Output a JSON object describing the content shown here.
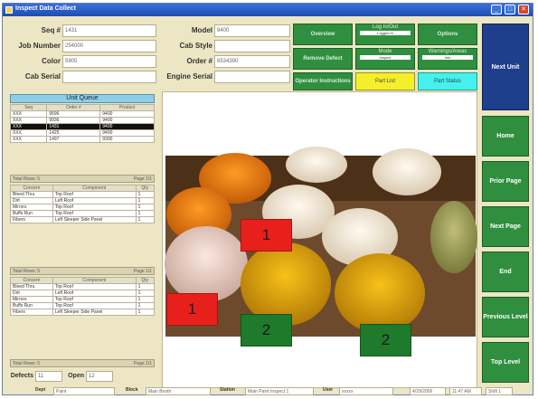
{
  "window": {
    "title": "Inspect Data Collect",
    "controls": [
      "_",
      "□",
      "✕"
    ]
  },
  "fields": {
    "seq": {
      "label": "Seq #",
      "value": "1431"
    },
    "job": {
      "label": "Job Number",
      "value": "254000"
    },
    "color": {
      "label": "Color",
      "value": "5905"
    },
    "cab_serial": {
      "label": "Cab Serial",
      "value": ""
    },
    "model": {
      "label": "Model",
      "value": "9400"
    },
    "cab_style": {
      "label": "Cab Style",
      "value": ""
    },
    "order": {
      "label": "Order #",
      "value": "6534390"
    },
    "engine_serial": {
      "label": "Engine Serial",
      "value": ""
    }
  },
  "actions": {
    "overview": "Overview",
    "log_in_out": "Log In/Out",
    "log_in_out_sub": "Logged In",
    "options": "Options",
    "remove_defect": "Remove Defect",
    "mode": "Mode",
    "mode_sub": "Inspect",
    "warnings": "Warnings/Areas",
    "warnings_sub": "Info",
    "operator_instructions": "Operator Instructions",
    "part_list": "Part List",
    "part_status": "Part Status"
  },
  "nav": {
    "next_unit": "Next Unit",
    "home": "Home",
    "prior_page": "Prior Page",
    "next_page": "Next Page",
    "end": "End",
    "previous_level": "Previous Level",
    "top_level": "Top Level"
  },
  "unit_queue": {
    "title": "Unit Queue",
    "headers": [
      "Seq",
      "Order #",
      "Product"
    ],
    "rows": [
      [
        "XXX",
        "9596",
        "9400"
      ],
      [
        "XXX",
        "9936",
        "9400"
      ],
      [
        "XXX",
        "1431",
        "9400"
      ],
      [
        "XXX",
        "1425",
        "9400"
      ],
      [
        "XXX",
        "1497",
        "9300"
      ]
    ],
    "selected_index": 2,
    "footer_left": "Total Rows: 5",
    "footer_right": "Page 1/1"
  },
  "defect_table_1": {
    "headers": [
      "Concern",
      "Component",
      "Qty"
    ],
    "rows": [
      [
        "Bleed Thru",
        "Top Roof",
        "1"
      ],
      [
        "Dirt",
        "Left Roof",
        "1"
      ],
      [
        "Mirrors",
        "Top Roof",
        "1"
      ],
      [
        "Buffs Run",
        "Top Roof",
        "1"
      ],
      [
        "Fibers",
        "Left Sleeper Side Panel",
        "1"
      ]
    ],
    "footer_left": "Total Rows: 5",
    "footer_right": "Page 1/1"
  },
  "defect_table_2": {
    "headers": [
      "Concern",
      "Component",
      "Qty"
    ],
    "rows": [
      [
        "Bleed Thru",
        "Top Roof",
        "1"
      ],
      [
        "Dirt",
        "Left Roof",
        "1"
      ],
      [
        "Mirrors",
        "Top Roof",
        "1"
      ],
      [
        "Buffs Run",
        "Top Roof",
        "1"
      ],
      [
        "Fibers",
        "Left Sleeper Side Panel",
        "1"
      ]
    ],
    "footer_left": "Total Rows: 5",
    "footer_right": "Page 1/1"
  },
  "counts": {
    "defects_label": "Defects",
    "defects_value": "11",
    "open_label": "Open",
    "open_value": "12"
  },
  "markers": [
    {
      "label": "1",
      "color": "#e8201c"
    },
    {
      "label": "1",
      "color": "#e8201c"
    },
    {
      "label": "2",
      "color": "#1f7a2c"
    },
    {
      "label": "2",
      "color": "#1f7a2c"
    }
  ],
  "statusbar": {
    "dept_label": "Dept",
    "dept_value": "Paint",
    "block_label": "Block",
    "block_value": "Main Booth",
    "station_label": "Station",
    "station_value": "Main Paint Inspect 1",
    "user_label": "User",
    "user_value": "xxxxx",
    "date": "4/29/2006",
    "time": "11:47 AM",
    "shift": "Shift 1"
  }
}
